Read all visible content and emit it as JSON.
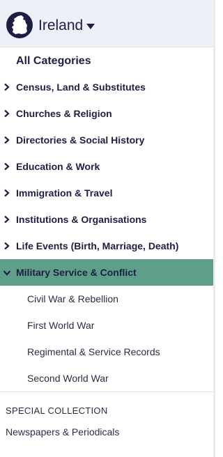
{
  "country_selector": {
    "name": "Ireland",
    "flag_icon": "ireland-map-icon",
    "caret_icon": "caret-down-icon"
  },
  "nav": {
    "all_label": "All Categories",
    "categories": [
      {
        "label": "Census, Land & Substitutes",
        "expanded": false
      },
      {
        "label": "Churches & Religion",
        "expanded": false
      },
      {
        "label": "Directories & Social History",
        "expanded": false
      },
      {
        "label": "Education & Work",
        "expanded": false
      },
      {
        "label": "Immigration & Travel",
        "expanded": false
      },
      {
        "label": "Institutions & Organisations",
        "expanded": false
      },
      {
        "label": "Life Events (Birth, Marriage, Death)",
        "expanded": false
      },
      {
        "label": "Military Service & Conflict",
        "expanded": true
      }
    ],
    "subcategories": [
      {
        "label": "Civil War & Rebellion"
      },
      {
        "label": "First World War"
      },
      {
        "label": "Regimental & Service Records"
      },
      {
        "label": "Second World War"
      }
    ]
  },
  "special_collection": {
    "title": "SPECIAL COLLECTION",
    "items": [
      {
        "label": "Newspapers & Periodicals"
      }
    ]
  },
  "colors": {
    "active_bg": "#5f9f89",
    "header_bg": "#eef0f8",
    "text_dark": "#1c1f44"
  }
}
